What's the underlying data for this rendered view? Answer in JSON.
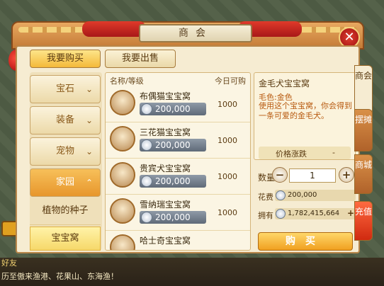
{
  "window": {
    "title": "商会"
  },
  "tabs": {
    "buy": "我要购买",
    "sell": "我要出售"
  },
  "categories": [
    {
      "label": "宝石"
    },
    {
      "label": "装备"
    },
    {
      "label": "宠物"
    },
    {
      "label": "家园"
    }
  ],
  "subcategories": [
    {
      "label": "植物的种子"
    },
    {
      "label": "宝宝窝"
    }
  ],
  "list": {
    "header_name": "名称/等级",
    "header_qty": "今日可购",
    "items": [
      {
        "name": "布偶猫宝宝窝",
        "price": "200,000",
        "qty": "1000"
      },
      {
        "name": "三花猫宝宝窝",
        "price": "200,000",
        "qty": "1000"
      },
      {
        "name": "贵宾犬宝宝窝",
        "price": "200,000",
        "qty": "1000"
      },
      {
        "name": "雪纳瑞宝宝窝",
        "price": "200,000",
        "qty": "1000"
      },
      {
        "name": "哈士奇宝宝窝",
        "price": "",
        "qty": ""
      }
    ]
  },
  "detail": {
    "title": "金毛犬宝宝窝",
    "color": "毛色:金色",
    "description": "使用这个宝宝窝，你会得到一条可爱的金毛犬。",
    "trend_label": "价格涨跌",
    "trend_value": "-",
    "qty_label": "数量",
    "qty_value": "1",
    "cost_label": "花费",
    "cost_value": "200,000",
    "own_label": "拥有",
    "own_value": "1,782,415,664",
    "buy_label": "购买"
  },
  "side_tabs": {
    "t1": "商会",
    "t2": "摆摊",
    "t3": "商城",
    "t4": "充值"
  },
  "chat": {
    "line1": "好友",
    "line2": "历至傲来渔港、花果山、东海渔！"
  },
  "colors": {
    "accent": "#f0a020",
    "frame": "#b8864a",
    "panel": "#f6ecd2"
  }
}
